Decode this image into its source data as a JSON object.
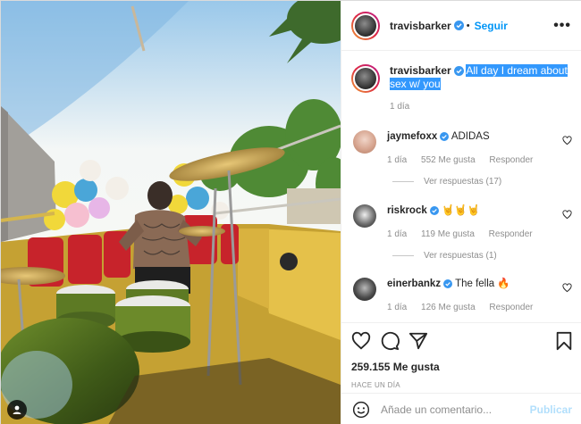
{
  "header": {
    "username": "travisbarker",
    "follow_label": "Seguir",
    "more_label": "•••"
  },
  "caption": {
    "username": "travisbarker",
    "text": "All day I dream about sex w/ you",
    "time": "1 día"
  },
  "comments": [
    {
      "username": "jaymefoxx",
      "verified": true,
      "text": "ADIDAS",
      "time": "1 día",
      "likes": "552 Me gusta",
      "reply_label": "Responder",
      "replies_label": "Ver respuestas (17)"
    },
    {
      "username": "riskrock",
      "verified": true,
      "text": "🤘🤘🤘",
      "time": "1 día",
      "likes": "119 Me gusta",
      "reply_label": "Responder",
      "replies_label": "Ver respuestas (1)"
    },
    {
      "username": "einerbankz",
      "verified": true,
      "text": "The fella 🔥",
      "time": "1 día",
      "likes": "126 Me gusta",
      "reply_label": "Responder"
    }
  ],
  "actions": {
    "likes": "259.155 Me gusta",
    "posted_ago": "HACE UN DÍA"
  },
  "add_comment": {
    "placeholder": "Añade un comentario...",
    "publish_label": "Publicar"
  },
  "colors": {
    "link_blue": "#0095f6",
    "selection": "#3298fd",
    "muted": "#8e8e8e"
  }
}
